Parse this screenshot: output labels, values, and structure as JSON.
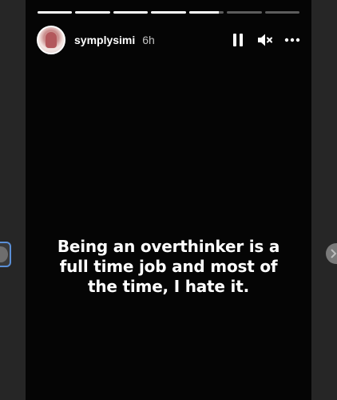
{
  "progress": [
    1,
    1,
    1,
    1,
    0.85,
    0,
    0
  ],
  "user": {
    "username": "symplysimi",
    "time": "6h"
  },
  "icons": {
    "pause": "pause-icon",
    "mute": "muted-speaker-icon",
    "more": "more-dots-icon",
    "next": "chevron-right-icon",
    "prev": "previous-story-button"
  },
  "story": {
    "caption_lines": [
      "Being an overthinker is a",
      "full time job and most of",
      "the time, I hate it."
    ]
  },
  "colors": {
    "background": "#262626",
    "story_bg": "#050505",
    "text": "#ffffff"
  }
}
